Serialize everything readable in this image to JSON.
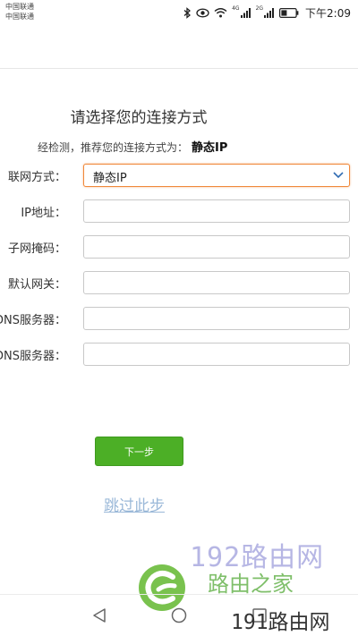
{
  "status_bar": {
    "carrier_1": "中国联通",
    "carrier_2": "中国联通",
    "signal_1_label": "4G",
    "signal_2_label": "2G",
    "time": "下午2:09"
  },
  "page": {
    "title": "请选择您的连接方式",
    "recommend_text": "经检测，推荐您的连接方式为：",
    "recommend_value": "静态IP"
  },
  "form": {
    "connection_type_label": "联网方式：",
    "connection_type_value": "静态IP",
    "ip_label": "IP地址：",
    "mask_label": "子网掩码：",
    "gateway_label": "默认网关：",
    "dns1_label": "DNS服务器：",
    "dns2_label": "DNS服务器：",
    "ip_value": "",
    "mask_value": "",
    "gateway_value": "",
    "dns1_value": "",
    "dns2_value": ""
  },
  "actions": {
    "next_label": "下一步",
    "skip_label": "跳过此步"
  },
  "watermark": {
    "line1": "192路由网",
    "line2": "路由之家",
    "line3": "191路由网"
  },
  "colors": {
    "accent_green": "#4caf26",
    "focus_orange": "#f0883a",
    "link_blue": "#9ab8d8"
  },
  "icons": {
    "select": "chevron-down-icon",
    "nav_back": "triangle-back-icon",
    "nav_home": "circle-home-icon",
    "nav_recent": "square-recent-icon"
  }
}
